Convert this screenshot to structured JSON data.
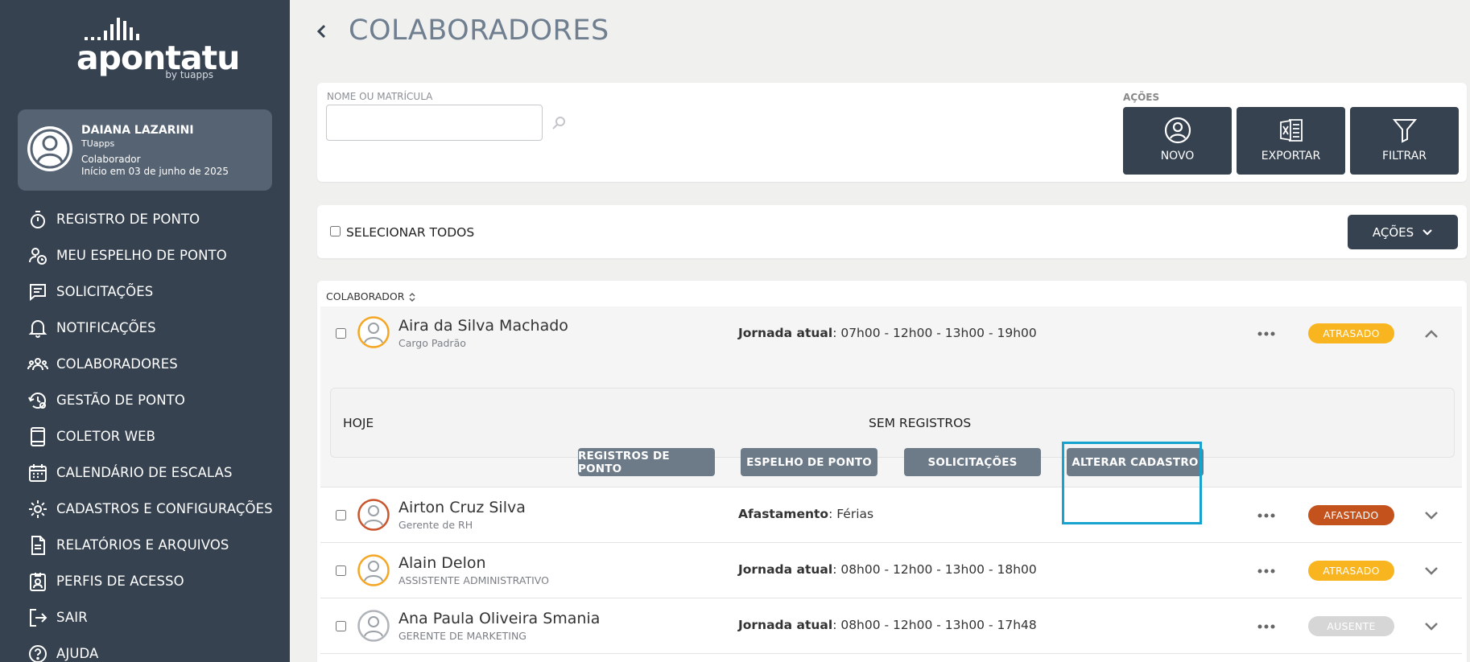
{
  "sidebar": {
    "logo_text": "apontatu",
    "logo_by": "by tuapps",
    "user": {
      "name": "DAIANA LAZARINI",
      "company": "TUapps",
      "role": "Colaborador",
      "start": "Início em 03 de junho de 2025"
    },
    "menu": [
      {
        "label": "REGISTRO DE PONTO",
        "icon": "stopwatch-icon"
      },
      {
        "label": "MEU ESPELHO DE PONTO",
        "icon": "user-clock-icon"
      },
      {
        "label": "SOLICITAÇÕES",
        "icon": "chat-list-icon"
      },
      {
        "label": "NOTIFICAÇÕES",
        "icon": "bell-icon"
      },
      {
        "label": "COLABORADORES",
        "icon": "users-icon"
      },
      {
        "label": "GESTÃO DE PONTO",
        "icon": "history-gear-icon"
      },
      {
        "label": "COLETOR WEB",
        "icon": "tablet-icon"
      },
      {
        "label": "CALENDÁRIO DE ESCALAS",
        "icon": "calendar-icon"
      },
      {
        "label": "CADASTROS E CONFIGURAÇÕES",
        "icon": "gear-icon"
      },
      {
        "label": "RELATÓRIOS E ARQUIVOS",
        "icon": "document-icon"
      },
      {
        "label": "PERFIS DE ACESSO",
        "icon": "id-badge-icon"
      },
      {
        "label": "SAIR",
        "icon": "logout-icon"
      },
      {
        "label": "AJUDA",
        "icon": "help-icon"
      }
    ]
  },
  "header": {
    "title": "COLABORADORES"
  },
  "filter": {
    "label": "NOME OU MATRÍCULA",
    "value": "",
    "actions_label": "AÇÕES",
    "actions": [
      {
        "label": "NOVO",
        "icon": "user-circle-icon"
      },
      {
        "label": "EXPORTAR",
        "icon": "excel-icon"
      },
      {
        "label": "FILTRAR",
        "icon": "filter-icon"
      }
    ]
  },
  "selection": {
    "select_all_label": "SELECIONAR TODOS",
    "actions_button": "AÇÕES"
  },
  "list": {
    "column_header": "COLABORADOR",
    "rows": [
      {
        "name": "Aira da Silva Machado",
        "sub": "Cargo Padrão",
        "info_label": "Jornada atual",
        "info_value": ": 07h00 - 12h00  -  13h00 - 19h00",
        "status": "ATRASADO",
        "status_color": "#f8b51f",
        "avatar_color": "#f5a623",
        "expanded": true
      },
      {
        "name": "Airton Cruz Silva",
        "sub": "Gerente de RH",
        "info_label": "Afastamento",
        "info_value": ": Férias",
        "status": "AFASTADO",
        "status_color": "#c4521c",
        "avatar_color": "#c8552b",
        "expanded": false
      },
      {
        "name": "Alain Delon",
        "sub": "ASSISTENTE ADMINISTRATIVO",
        "info_label": "Jornada atual",
        "info_value": ": 08h00 - 12h00  -  13h00 - 18h00",
        "status": "ATRASADO",
        "status_color": "#f8b51f",
        "avatar_color": "#f5a623",
        "expanded": false
      },
      {
        "name": "Ana Paula Oliveira Smania",
        "sub": "GERENTE DE MARKETING",
        "info_label": "Jornada atual",
        "info_value": ": 08h00 - 12h00  -  13h00 - 17h48",
        "status": "AUSENTE",
        "status_color": "#d6d6d6",
        "avatar_color": "#9aa0a6",
        "expanded": false
      }
    ],
    "expanded_detail": {
      "today_label": "HOJE",
      "today_status": "SEM REGISTROS",
      "buttons": [
        "REGISTROS DE PONTO",
        "ESPELHO DE PONTO",
        "SOLICITAÇÕES",
        "ALTERAR CADASTRO"
      ]
    }
  },
  "colors": {
    "sidebar_bg": "#364250",
    "accent_dark": "#364250",
    "sub_button": "#6d7a88",
    "highlight": "#16a4cf"
  }
}
